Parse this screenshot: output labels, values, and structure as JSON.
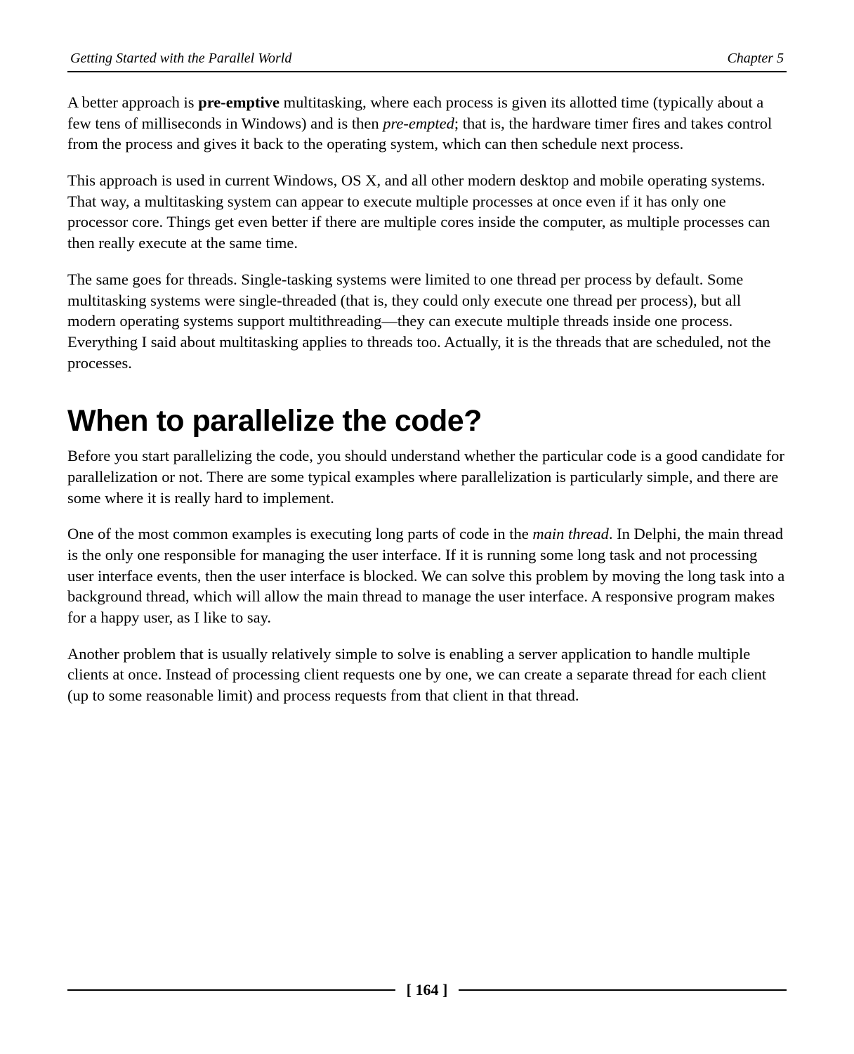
{
  "header": {
    "left": "Getting Started with the Parallel World",
    "right": "Chapter 5"
  },
  "paragraphs": {
    "p1_a": "A better approach is ",
    "p1_bold": "pre-emptive",
    "p1_b": " multitasking, where each process is given its allotted time (typically about a few tens of milliseconds in Windows) and is then ",
    "p1_italic": "pre-empted",
    "p1_c": "; that is, the hardware timer fires and takes control from the process and gives it back to the operating system, which can then schedule next process.",
    "p2": "This approach is used in current Windows, OS X, and all other modern desktop and mobile operating systems. That way, a multitasking system can appear to execute multiple processes at once even if it has only one processor core. Things get even better if there are multiple cores inside the computer, as multiple processes can then really execute at the same time.",
    "p3": "The same goes for threads. Single-tasking systems were limited to one thread per process by default. Some multitasking systems were single-threaded (that is, they could only execute one thread per process), but all modern operating systems support multithreading—they can execute multiple threads inside one process. Everything I said about multitasking applies to threads too. Actually, it is the threads that are scheduled, not the processes.",
    "heading": "When to parallelize the code?",
    "p4": "Before you start parallelizing the code, you should understand whether the particular code is a good candidate for parallelization or not. There are some typical examples where parallelization is particularly simple, and there are some where it is really hard to implement.",
    "p5_a": "One of the most common examples is executing long parts of code in the ",
    "p5_italic": "main thread",
    "p5_b": ". In Delphi, the main thread is the only one responsible for managing the user interface. If it is running some long task and not processing user interface events, then the user interface is blocked. We can solve this problem by moving the long task into a background thread, which will allow the main thread to manage the user interface. A responsive program makes for a happy user, as I like to say.",
    "p6": "Another problem that is usually relatively simple to solve is enabling a server application to handle multiple clients at once. Instead of processing client requests one by one, we can create a separate thread for each client (up to some reasonable limit) and process requests from that client in that thread."
  },
  "footer": {
    "page": "[ 164 ]"
  }
}
